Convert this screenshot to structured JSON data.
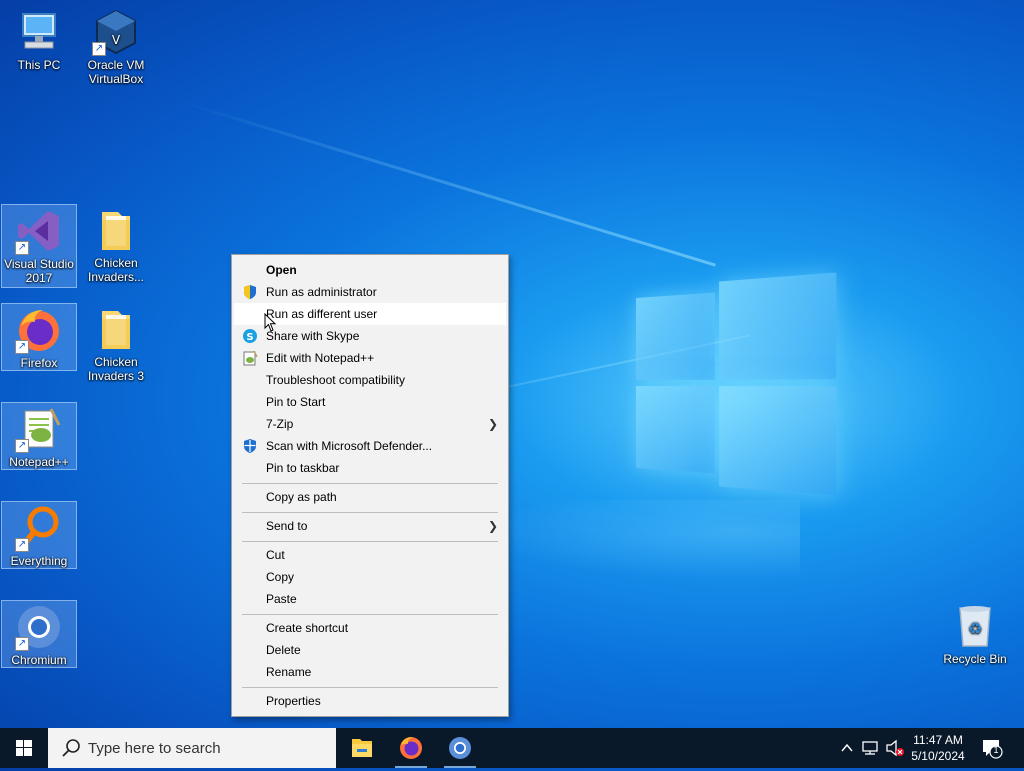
{
  "desktop": {
    "icons": [
      {
        "label": "This PC"
      },
      {
        "label": "Oracle VM VirtualBox"
      },
      {
        "label": "Visual Studio 2017"
      },
      {
        "label": "Chicken Invaders..."
      },
      {
        "label": "Firefox"
      },
      {
        "label": "Chicken Invaders 3"
      },
      {
        "label": "Notepad++"
      },
      {
        "label": "Everything"
      },
      {
        "label": "Chromium"
      },
      {
        "label": "Recycle Bin"
      }
    ]
  },
  "context_menu": {
    "items": [
      {
        "label": "Open",
        "icon": ""
      },
      {
        "label": "Run as administrator",
        "icon": "uac-shield-icon"
      },
      {
        "label": "Run as different user",
        "icon": ""
      },
      {
        "label": "Share with Skype",
        "icon": "skype-icon"
      },
      {
        "label": "Edit with Notepad++",
        "icon": "notepadpp-icon"
      },
      {
        "label": "Troubleshoot compatibility",
        "icon": ""
      },
      {
        "label": "Pin to Start",
        "icon": ""
      },
      {
        "label": "7-Zip",
        "icon": ""
      },
      {
        "label": "Scan with Microsoft Defender...",
        "icon": "defender-icon"
      },
      {
        "label": "Pin to taskbar",
        "icon": ""
      },
      {
        "label": "Copy as path",
        "icon": ""
      },
      {
        "label": "Send to",
        "icon": ""
      },
      {
        "label": "Cut",
        "icon": ""
      },
      {
        "label": "Copy",
        "icon": ""
      },
      {
        "label": "Paste",
        "icon": ""
      },
      {
        "label": "Create shortcut",
        "icon": ""
      },
      {
        "label": "Delete",
        "icon": ""
      },
      {
        "label": "Rename",
        "icon": ""
      },
      {
        "label": "Properties",
        "icon": ""
      }
    ]
  },
  "taskbar": {
    "search_placeholder": "Type here to search",
    "time": "11:47 AM",
    "date": "5/10/2024",
    "notification_count": "1"
  },
  "colors": {
    "taskbar": "#0a1929",
    "menu_bg": "#f2f2f2",
    "desktop_accent": "#0b73dc"
  }
}
